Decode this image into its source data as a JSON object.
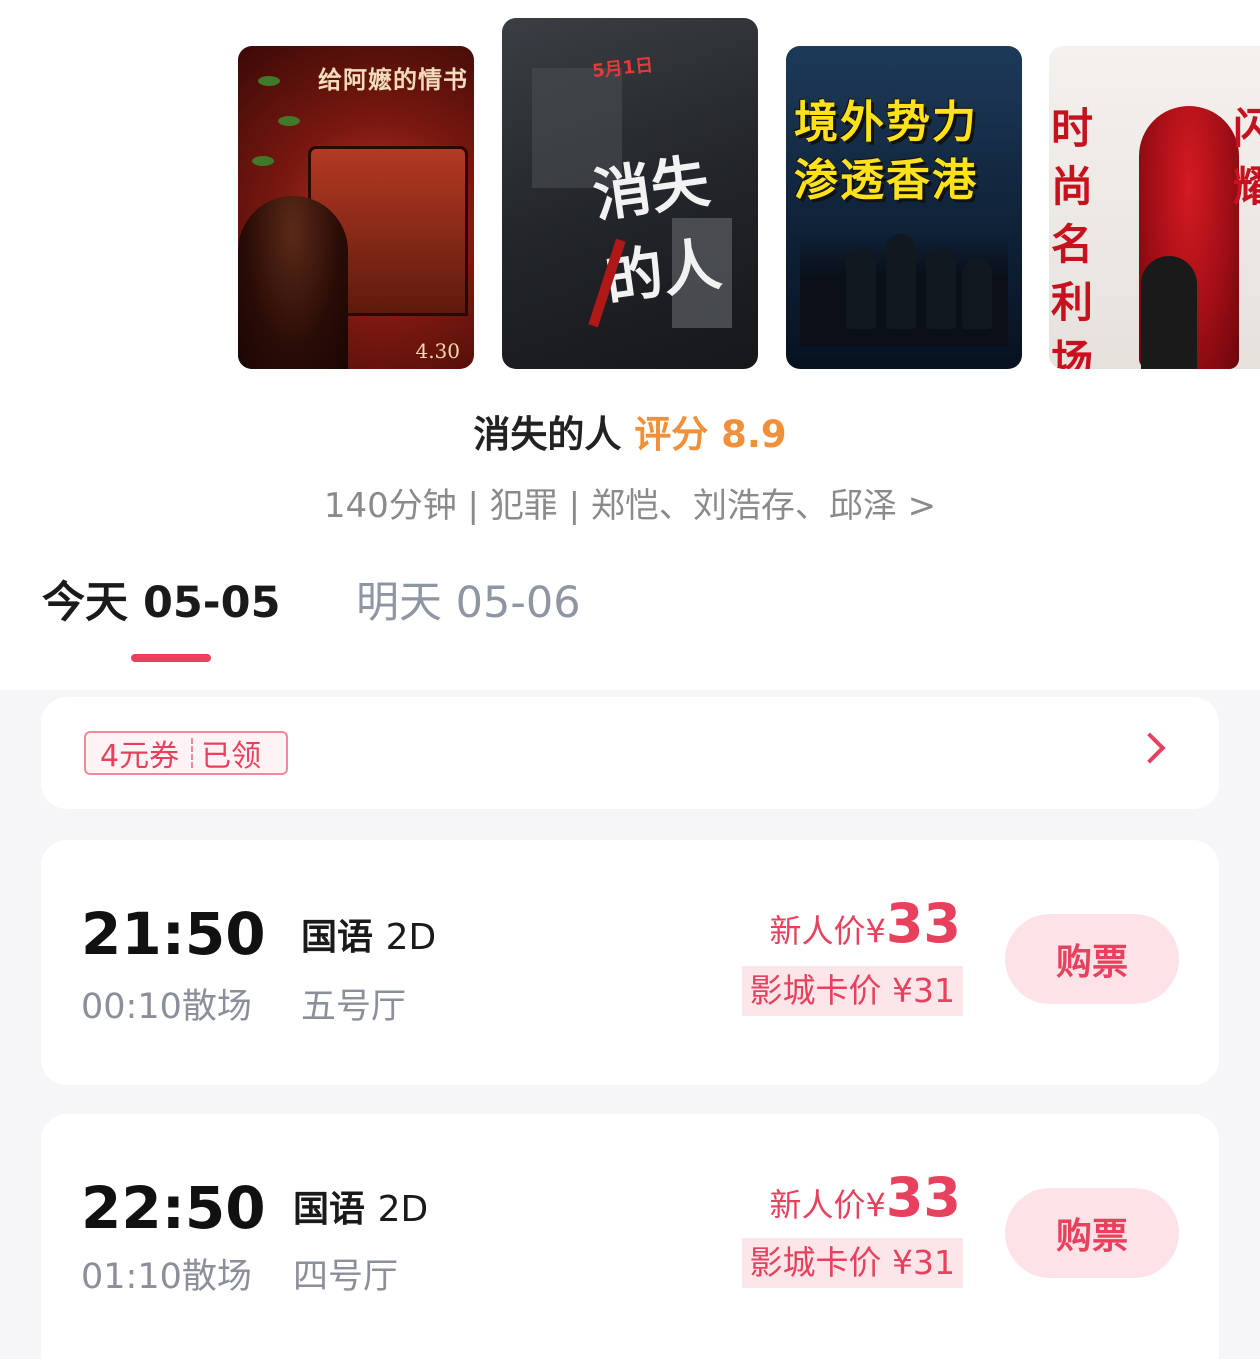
{
  "posters": [
    {
      "title": "给阿嬷的情书",
      "date": "4.30"
    },
    {
      "title": "消失的人",
      "release": "5月1日"
    },
    {
      "title": "境外势力 渗透香港"
    },
    {
      "title": "时尚名利场",
      "title_right": "闪耀"
    }
  ],
  "movie": {
    "name": "消失的人",
    "score_label": "评分",
    "score": "8.9",
    "meta": "140分钟 | 犯罪 | 郑恺、刘浩存、邱泽 >"
  },
  "date_tabs": [
    {
      "label": "今天 05-05",
      "selected": true
    },
    {
      "label": "明天 05-06",
      "selected": false
    }
  ],
  "coupon": {
    "amount": "4元券",
    "state": "已领"
  },
  "showtimes": [
    {
      "start": "21:50",
      "end": "00:10散场",
      "language": "国语",
      "format": "2D",
      "hall": "五号厅",
      "price_label": "新人价",
      "currency": "¥",
      "price": "33",
      "card_price": "影城卡价 ¥31",
      "buy_label": "购票"
    },
    {
      "start": "22:50",
      "end": "01:10散场",
      "language": "国语",
      "format": "2D",
      "hall": "四号厅",
      "price_label": "新人价",
      "currency": "¥",
      "price": "33",
      "card_price": "影城卡价 ¥31",
      "buy_label": "购票"
    }
  ],
  "colors": {
    "accent": "#e8415e",
    "score": "#f0903a",
    "background": "#f6f6f8"
  }
}
